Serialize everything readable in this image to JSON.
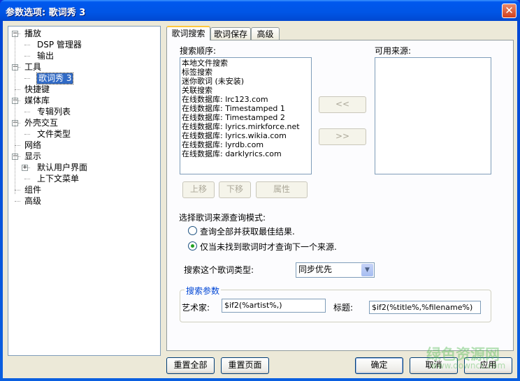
{
  "window": {
    "title": "参数选项: 歌词秀 3",
    "close": "✕"
  },
  "tree": {
    "items": [
      {
        "label": "播放",
        "expander": "⊟"
      },
      {
        "label": "DSP 管理器"
      },
      {
        "label": "输出"
      },
      {
        "label": "工具",
        "expander": "⊟"
      },
      {
        "label": "歌词秀 3",
        "selected": true
      },
      {
        "label": "快捷键"
      },
      {
        "label": "媒体库",
        "expander": "⊟"
      },
      {
        "label": "专辑列表"
      },
      {
        "label": "外壳交互",
        "expander": "⊟"
      },
      {
        "label": "文件类型"
      },
      {
        "label": "网络"
      },
      {
        "label": "显示",
        "expander": "⊟"
      },
      {
        "label": "默认用户界面",
        "expander": "⊞"
      },
      {
        "label": "上下文菜单"
      },
      {
        "label": "组件"
      },
      {
        "label": "高级"
      }
    ]
  },
  "tabs": [
    "歌词搜索",
    "歌词保存",
    "高级"
  ],
  "search": {
    "order_label": "搜索顺序:",
    "order_items": [
      "本地文件搜索",
      "标签搜索",
      "迷你歌词 (未安装)",
      "关联搜索",
      "在线数据库: lrc123.com",
      "在线数据库: Timestamped 1",
      "在线数据库: Timestamped 2",
      "在线数据库: lyrics.mirkforce.net",
      "在线数据库: lyrics.wikia.com",
      "在线数据库: lyrdb.com",
      "在线数据库: darklyrics.com"
    ],
    "available_label": "可用来源:",
    "add_btn": "<<",
    "remove_btn": ">>",
    "up_btn": "上移",
    "down_btn": "下移",
    "props_btn": "属性",
    "mode_label": "选择歌词来源查询模式:",
    "mode_options": [
      "查询全部并获取最佳结果.",
      "仅当未找到歌词时才查询下一个来源."
    ],
    "type_label": "搜索这个歌词类型:",
    "type_value": "同步优先",
    "params_legend": "搜索参数",
    "artist_label": "艺术家:",
    "artist_value": "$if2(%artist%,)",
    "title_label": "标题:",
    "title_value": "$if2(%title%,%filename%)"
  },
  "footer": {
    "reset_all": "重置全部",
    "reset_page": "重置页面",
    "ok": "确定",
    "cancel": "取消",
    "apply": "应用"
  },
  "watermark": {
    "name": "绿色资源网",
    "url": "www.downcc.com"
  }
}
